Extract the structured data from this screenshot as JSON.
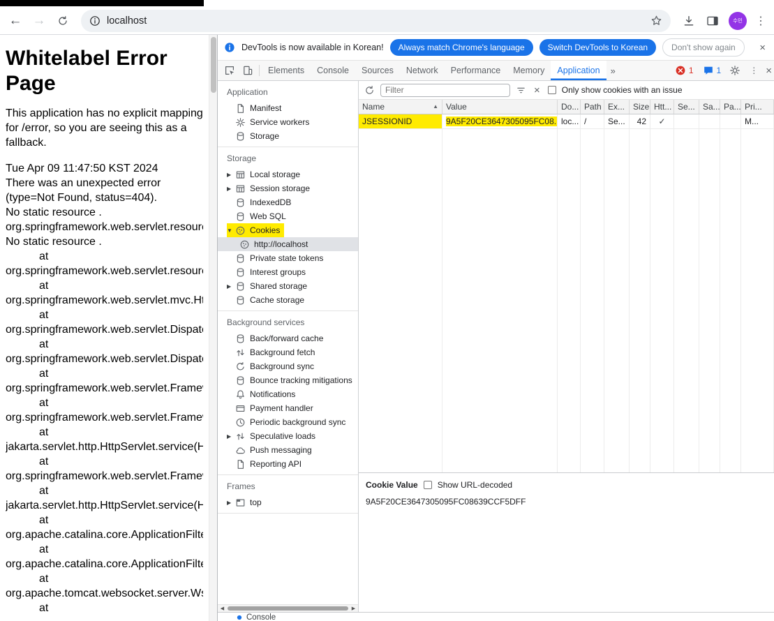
{
  "browser": {
    "url": "localhost",
    "avatar_text": "수민"
  },
  "error_page": {
    "heading": "Whitelabel Error Page",
    "intro": "This application has no explicit mapping for /error, so you are seeing this as a fallback.",
    "timestamp": "Tue Apr 09 11:47:50 KST 2024",
    "error_summary": "There was an unexpected error (type=Not Found, status=404).",
    "message": "No static resource .",
    "exception_class": "org.springframework.web.servlet.resourc",
    "exception_message": "No static resource .",
    "at": "at",
    "trace": [
      "org.springframework.web.servlet.resourc",
      "org.springframework.web.servlet.mvc.Htt",
      "org.springframework.web.servlet.Dispatc",
      "org.springframework.web.servlet.Dispatc",
      "org.springframework.web.servlet.Framew",
      "org.springframework.web.servlet.Framew",
      "jakarta.servlet.http.HttpServlet.service(Ht",
      "org.springframework.web.servlet.Framew",
      "jakarta.servlet.http.HttpServlet.service(Ht",
      "org.apache.catalina.core.ApplicationFilter",
      "org.apache.catalina.core.ApplicationFilter",
      "org.apache.tomcat.websocket.server.WsF"
    ],
    "trailing_at": "at"
  },
  "devtools": {
    "notification": {
      "message": "DevTools is now available in Korean!",
      "match_button": "Always match Chrome's language",
      "switch_button": "Switch DevTools to Korean",
      "dismiss_button": "Don't show again",
      "close": "×"
    },
    "tabbar": {
      "tabs": [
        "Elements",
        "Console",
        "Sources",
        "Network",
        "Performance",
        "Memory",
        "Application"
      ],
      "active_tab": "Application",
      "more": "»",
      "error_count": "1",
      "issue_count": "1",
      "close": "×"
    },
    "sidebar": {
      "sections": [
        {
          "title": "Application",
          "items": [
            {
              "label": "Manifest",
              "icon": "doc-icon"
            },
            {
              "label": "Service workers",
              "icon": "gear-icon"
            },
            {
              "label": "Storage",
              "icon": "database-icon"
            }
          ]
        },
        {
          "title": "Storage",
          "items": [
            {
              "label": "Local storage",
              "icon": "table-icon",
              "arrow": "▶"
            },
            {
              "label": "Session storage",
              "icon": "table-icon",
              "arrow": "▶"
            },
            {
              "label": "IndexedDB",
              "icon": "database-icon"
            },
            {
              "label": "Web SQL",
              "icon": "database-icon"
            },
            {
              "label": "Cookies",
              "icon": "cookie-icon",
              "arrow": "▼",
              "highlighted": true
            },
            {
              "label": "http://localhost",
              "icon": "cookie-icon",
              "child": true,
              "selected": true
            },
            {
              "label": "Private state tokens",
              "icon": "database-icon"
            },
            {
              "label": "Interest groups",
              "icon": "database-icon"
            },
            {
              "label": "Shared storage",
              "icon": "database-icon",
              "arrow": "▶"
            },
            {
              "label": "Cache storage",
              "icon": "database-icon"
            }
          ]
        },
        {
          "title": "Background services",
          "items": [
            {
              "label": "Back/forward cache",
              "icon": "database-icon"
            },
            {
              "label": "Background fetch",
              "icon": "updown-arrows-icon"
            },
            {
              "label": "Background sync",
              "icon": "sync-icon"
            },
            {
              "label": "Bounce tracking mitigations",
              "icon": "database-icon"
            },
            {
              "label": "Notifications",
              "icon": "bell-icon"
            },
            {
              "label": "Payment handler",
              "icon": "card-icon"
            },
            {
              "label": "Periodic background sync",
              "icon": "clock-icon"
            },
            {
              "label": "Speculative loads",
              "icon": "updown-arrows-icon",
              "arrow": "▶"
            },
            {
              "label": "Push messaging",
              "icon": "cloud-icon"
            },
            {
              "label": "Reporting API",
              "icon": "doc-icon"
            }
          ]
        },
        {
          "title": "Frames",
          "items": [
            {
              "label": "top",
              "icon": "frame-icon",
              "arrow": "▶"
            }
          ]
        }
      ]
    },
    "cookies": {
      "filter_placeholder": "Filter",
      "only_issue_label": "Only show cookies with an issue",
      "columns": [
        "Name",
        "Value",
        "Do...",
        "Path",
        "Ex...",
        "Size",
        "Htt...",
        "Se...",
        "Sa...",
        "Pa...",
        "Pri..."
      ],
      "sort_indicator": "▲",
      "row": {
        "name": "JSESSIONID",
        "value": "9A5F20CE3647305095FC08...",
        "domain": "loc...",
        "path": "/",
        "expires": "Se...",
        "size": "42",
        "http_only": "✓",
        "secure": "",
        "same_site": "",
        "partition": "",
        "priority": "M..."
      },
      "footer": {
        "label": "Cookie Value",
        "url_decoded_label": "Show URL-decoded",
        "value": "9A5F20CE3647305095FC08639CCF5DFF"
      }
    },
    "drawer": {
      "console_tab": "Console"
    }
  },
  "colors": {
    "accent_blue": "#1a73e8",
    "highlight_yellow": "#ffeb00",
    "error_red": "#d93025",
    "avatar_purple": "#9334e6",
    "selected_gray": "#e0e2e6"
  }
}
